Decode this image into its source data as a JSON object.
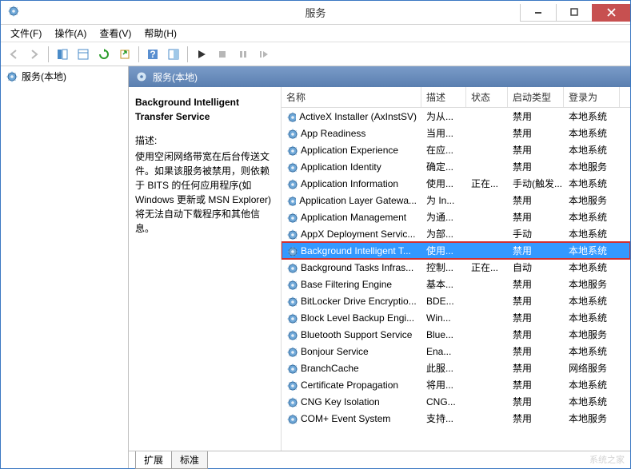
{
  "window": {
    "title": "服务"
  },
  "menu": {
    "file": "文件(F)",
    "action": "操作(A)",
    "view": "查看(V)",
    "help": "帮助(H)"
  },
  "tree": {
    "root": "服务(本地)"
  },
  "panel_header": "服务(本地)",
  "detail": {
    "title": "Background Intelligent Transfer Service",
    "desc_label": "描述:",
    "desc_text": "使用空闲网络带宽在后台传送文件。如果该服务被禁用，则依赖于 BITS 的任何应用程序(如 Windows 更新或 MSN Explorer)将无法自动下载程序和其他信息。"
  },
  "columns": {
    "name": "名称",
    "desc": "描述",
    "state": "状态",
    "startup": "启动类型",
    "logon": "登录为"
  },
  "services": [
    {
      "name": "ActiveX Installer (AxInstSV)",
      "desc": "为从...",
      "state": "",
      "startup": "禁用",
      "logon": "本地系统"
    },
    {
      "name": "App Readiness",
      "desc": "当用...",
      "state": "",
      "startup": "禁用",
      "logon": "本地系统"
    },
    {
      "name": "Application Experience",
      "desc": "在应...",
      "state": "",
      "startup": "禁用",
      "logon": "本地系统"
    },
    {
      "name": "Application Identity",
      "desc": "确定...",
      "state": "",
      "startup": "禁用",
      "logon": "本地服务"
    },
    {
      "name": "Application Information",
      "desc": "使用...",
      "state": "正在...",
      "startup": "手动(触发...",
      "logon": "本地系统"
    },
    {
      "name": "Application Layer Gatewa...",
      "desc": "为 In...",
      "state": "",
      "startup": "禁用",
      "logon": "本地服务"
    },
    {
      "name": "Application Management",
      "desc": "为通...",
      "state": "",
      "startup": "禁用",
      "logon": "本地系统"
    },
    {
      "name": "AppX Deployment Servic...",
      "desc": "为部...",
      "state": "",
      "startup": "手动",
      "logon": "本地系统"
    },
    {
      "name": "Background Intelligent T...",
      "desc": "使用...",
      "state": "",
      "startup": "禁用",
      "logon": "本地系统",
      "selected": true
    },
    {
      "name": "Background Tasks Infras...",
      "desc": "控制...",
      "state": "正在...",
      "startup": "自动",
      "logon": "本地系统"
    },
    {
      "name": "Base Filtering Engine",
      "desc": "基本...",
      "state": "",
      "startup": "禁用",
      "logon": "本地服务"
    },
    {
      "name": "BitLocker Drive Encryptio...",
      "desc": "BDE...",
      "state": "",
      "startup": "禁用",
      "logon": "本地系统"
    },
    {
      "name": "Block Level Backup Engi...",
      "desc": "Win...",
      "state": "",
      "startup": "禁用",
      "logon": "本地系统"
    },
    {
      "name": "Bluetooth Support Service",
      "desc": "Blue...",
      "state": "",
      "startup": "禁用",
      "logon": "本地服务"
    },
    {
      "name": "Bonjour Service",
      "desc": "Ena...",
      "state": "",
      "startup": "禁用",
      "logon": "本地系统"
    },
    {
      "name": "BranchCache",
      "desc": "此服...",
      "state": "",
      "startup": "禁用",
      "logon": "网络服务"
    },
    {
      "name": "Certificate Propagation",
      "desc": "将用...",
      "state": "",
      "startup": "禁用",
      "logon": "本地系统"
    },
    {
      "name": "CNG Key Isolation",
      "desc": "CNG...",
      "state": "",
      "startup": "禁用",
      "logon": "本地系统"
    },
    {
      "name": "COM+ Event System",
      "desc": "支持...",
      "state": "",
      "startup": "禁用",
      "logon": "本地服务"
    }
  ],
  "tabs": {
    "extended": "扩展",
    "standard": "标准"
  },
  "watermark": "系统之家"
}
